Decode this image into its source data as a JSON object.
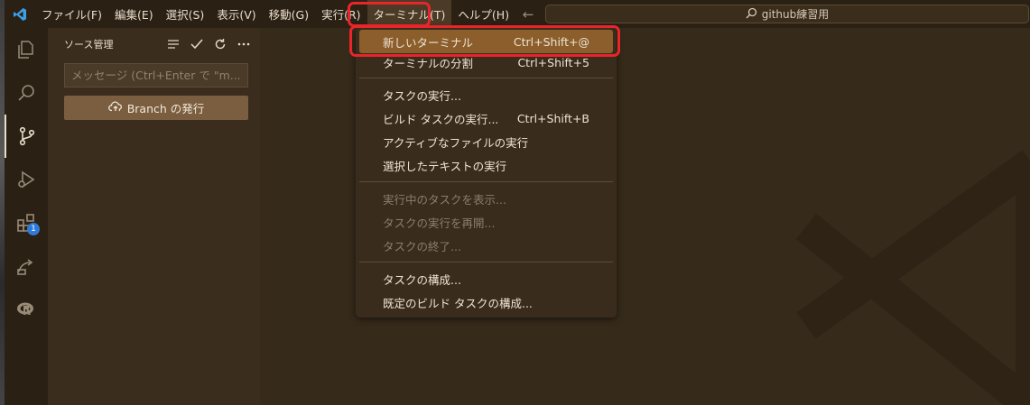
{
  "titlebar": {
    "menus": [
      "ファイル(F)",
      "編集(E)",
      "選択(S)",
      "表示(V)",
      "移動(G)",
      "実行(R)",
      "ターミナル(T)",
      "ヘルプ(H)"
    ],
    "search_text": "github練習用"
  },
  "sidebar": {
    "title": "ソース管理",
    "commit_placeholder": "メッセージ (Ctrl+Enter で \"m...",
    "publish_label": "Branch の発行"
  },
  "activity": {
    "extensions_badge": "1"
  },
  "terminal_menu": {
    "items": [
      {
        "label": "新しいターミナル",
        "shortcut": "Ctrl+Shift+@"
      },
      {
        "label": "ターミナルの分割",
        "shortcut": "Ctrl+Shift+5"
      },
      {
        "label": "タスクの実行...",
        "shortcut": ""
      },
      {
        "label": "ビルド タスクの実行...",
        "shortcut": "Ctrl+Shift+B"
      },
      {
        "label": "アクティブなファイルの実行",
        "shortcut": ""
      },
      {
        "label": "選択したテキストの実行",
        "shortcut": ""
      },
      {
        "label": "実行中のタスクを表示...",
        "shortcut": ""
      },
      {
        "label": "タスクの実行を再開...",
        "shortcut": ""
      },
      {
        "label": "タスクの終了...",
        "shortcut": ""
      },
      {
        "label": "タスクの構成...",
        "shortcut": ""
      },
      {
        "label": "既定のビルド タスクの構成...",
        "shortcut": ""
      }
    ]
  },
  "colors": {
    "accent": "#8b5e2c",
    "annotation": "#e8252b",
    "badge": "#2f7ad6"
  }
}
